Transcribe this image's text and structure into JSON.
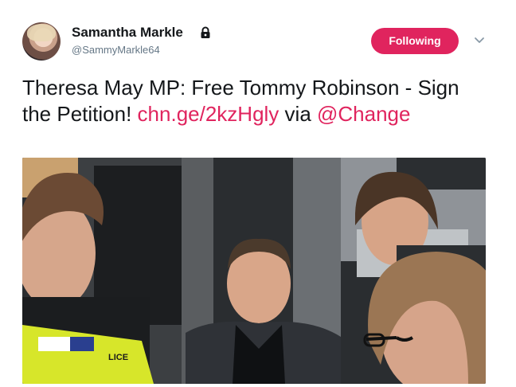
{
  "tweet": {
    "author": {
      "display_name": "Samantha Markle",
      "handle": "@SammyMarkle64",
      "protected_icon": "lock-icon"
    },
    "follow_button_label": "Following",
    "menu_icon": "chevron-down-icon",
    "text": {
      "part1": "Theresa May MP: Free Tommy Robinson - Sign the Petition! ",
      "link": "chn.ge/2kzHgly",
      "part2": " via ",
      "mention": "@Change"
    },
    "media": {
      "kind": "photo",
      "vest_text": "LICE"
    }
  },
  "colors": {
    "accent": "#e0245e",
    "text": "#14171a",
    "muted": "#657786"
  }
}
